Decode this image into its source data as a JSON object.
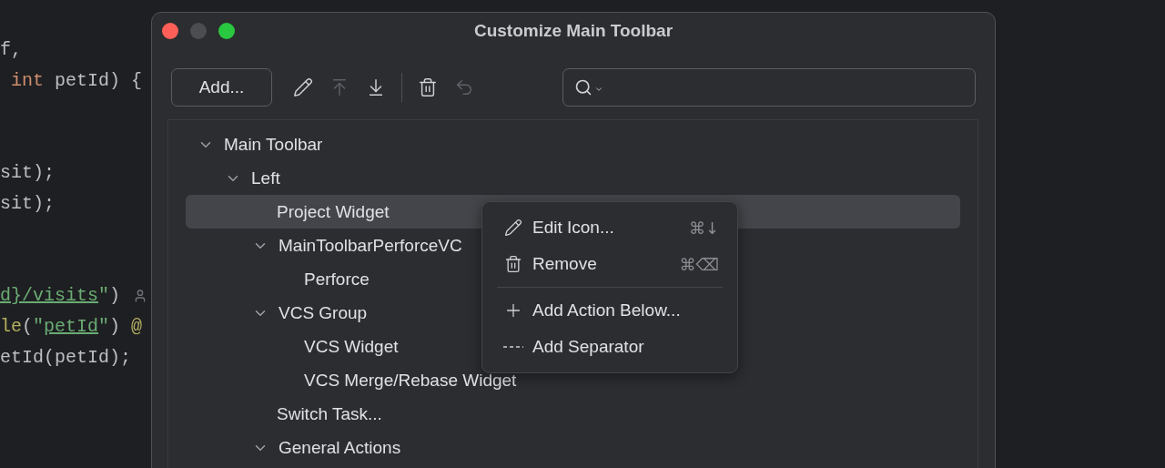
{
  "editor": {
    "blocks": [
      {
        "lines": [
          {
            "tokens": [
              {
                "kind": "plain",
                "text": "f,"
              }
            ]
          },
          {
            "tokens": [
              {
                "kind": "keyword",
                "text": " int"
              },
              {
                "kind": "plain",
                "text": " petId) {"
              }
            ]
          }
        ]
      },
      {
        "lines": [
          {
            "tokens": [
              {
                "kind": "plain",
                "text": "sit);"
              }
            ]
          },
          {
            "tokens": [
              {
                "kind": "plain",
                "text": "sit);"
              }
            ]
          }
        ]
      },
      {
        "lines": [
          {
            "tokens": [
              {
                "kind": "link",
                "text": "d}/visits"
              },
              {
                "kind": "string",
                "text": "\""
              },
              {
                "kind": "plain",
                "text": ")"
              },
              {
                "kind": "user_hint"
              }
            ]
          },
          {
            "tokens": [
              {
                "kind": "annotation",
                "text": "le"
              },
              {
                "kind": "plain",
                "text": "("
              },
              {
                "kind": "string",
                "text": "\""
              },
              {
                "kind": "link",
                "text": "petId"
              },
              {
                "kind": "string",
                "text": "\""
              },
              {
                "kind": "plain",
                "text": ") "
              },
              {
                "kind": "annotation",
                "text": "@"
              }
            ]
          },
          {
            "tokens": [
              {
                "kind": "plain",
                "text": "etId(petId);"
              }
            ]
          }
        ]
      }
    ]
  },
  "dialog": {
    "title": "Customize Main Toolbar",
    "add_button": "Add...",
    "toolbar": [
      {
        "kind": "edit",
        "disabled": false
      },
      {
        "kind": "move_up",
        "disabled": true
      },
      {
        "kind": "move_down",
        "disabled": false
      },
      {
        "kind": "divider"
      },
      {
        "kind": "remove",
        "disabled": false
      },
      {
        "kind": "restore",
        "disabled": true
      }
    ],
    "tree": [
      {
        "label": "Main Toolbar",
        "expanded": true,
        "selected": false,
        "children": [
          {
            "label": "Left",
            "expanded": true,
            "selected": false,
            "children": [
              {
                "label": "Project Widget",
                "selected": true
              },
              {
                "label": "MainToolbarPerforceVC",
                "expanded": true,
                "selected": false,
                "children": [
                  {
                    "label": "Perforce",
                    "selected": false
                  }
                ]
              },
              {
                "label": "VCS Group",
                "expanded": true,
                "selected": false,
                "children": [
                  {
                    "label": "VCS Widget",
                    "selected": false
                  },
                  {
                    "label": "VCS Merge/Rebase Widget",
                    "selected": false
                  }
                ]
              },
              {
                "label": "Switch Task...",
                "selected": false
              },
              {
                "label": "General Actions",
                "expanded": true,
                "selected": false
              }
            ]
          }
        ]
      }
    ],
    "context_menu": [
      {
        "kind": "edit",
        "label": "Edit Icon...",
        "shortcut": "⌘↓"
      },
      {
        "kind": "remove",
        "label": "Remove",
        "shortcut": "⌘⌫"
      },
      {
        "kind": "separator"
      },
      {
        "kind": "add",
        "label": "Add Action Below..."
      },
      {
        "kind": "add_separator",
        "label": "Add Separator"
      }
    ]
  }
}
